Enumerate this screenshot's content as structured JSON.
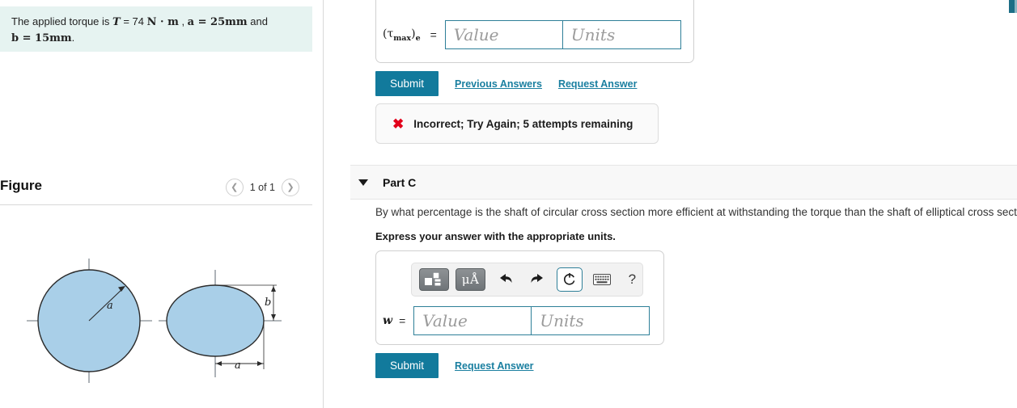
{
  "given": {
    "text_lead": "The applied torque is ",
    "T_symbol": "T",
    "eq1": " = 74 ",
    "units": "N · m",
    "comma": " , ",
    "a_expr": "a = 25mm",
    "and": " and",
    "b_expr": "b = 15mm",
    "period": "."
  },
  "figure": {
    "title": "Figure",
    "pager_label": "1 of 1",
    "prev_icon": "chevron-left-icon",
    "next_icon": "chevron-right-icon",
    "circle_label": "a",
    "ellipse_label_h": "a",
    "ellipse_label_v": "b",
    "fill_color": "#a9cfe8",
    "stroke_color": "#2b2b2b"
  },
  "part_b": {
    "answer_label_tau": "τ",
    "answer_label_sub": "max",
    "answer_label_e": "e",
    "equals": "=",
    "value_placeholder": "Value",
    "units_placeholder": "Units",
    "value_current": "",
    "units_current": "",
    "submit_label": "Submit",
    "previous_answers_label": "Previous Answers",
    "request_answer_label": "Request Answer",
    "feedback_icon": "red-x-icon",
    "feedback_text": "Incorrect; Try Again; 5 attempts remaining"
  },
  "part_c": {
    "caret_icon": "caret-down-icon",
    "title": "Part C",
    "question": "By what percentage is the shaft of circular cross section more efficient at withstanding the torque than the shaft of elliptical cross section?",
    "instruction": "Express your answer with the appropriate units.",
    "toolbar": {
      "template_icon": "math-template-icon",
      "units_icon": "micro-angstrom-units-icon",
      "units_label": "μÅ",
      "undo_icon": "undo-arrow-icon",
      "undo_glyph": "⬅",
      "redo_icon": "redo-arrow-icon",
      "redo_glyph": "➡",
      "reset_icon": "reset-circular-arrow-icon",
      "keyboard_icon": "keyboard-icon",
      "help_icon": "help-question-icon",
      "help_glyph": "?",
      "reset_highlight_color": "#2e7f98"
    },
    "answer_label": "w",
    "equals": "=",
    "value_placeholder": "Value",
    "units_placeholder": "Units",
    "value_current": "",
    "units_current": "",
    "submit_label": "Submit",
    "request_answer_label": "Request Answer"
  },
  "colors": {
    "accent_teal": "#127a9c",
    "link_teal": "#1a7fa0",
    "given_bg": "#e6f3f1",
    "band_bg": "#f8f8f8",
    "error_red": "#e2001a"
  }
}
